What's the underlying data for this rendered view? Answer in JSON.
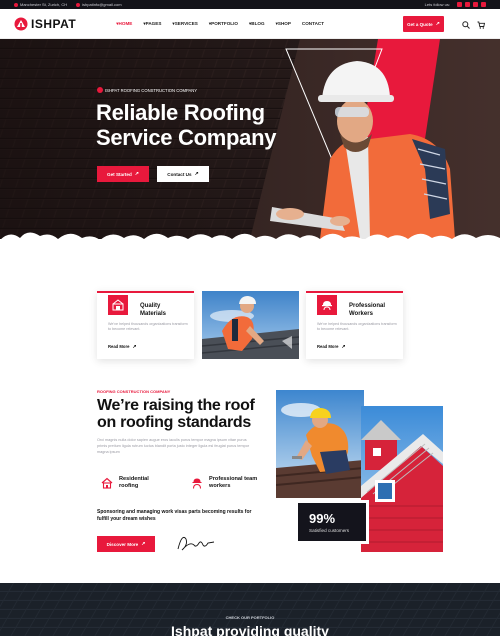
{
  "topbar": {
    "address": "Manchester St, Zurich, CH",
    "email": "ishpatinfo@gmail.com",
    "follow_label": "Lets follow us:",
    "social_icons": [
      "facebook-icon",
      "instagram-icon",
      "twitter-icon",
      "youtube-icon"
    ]
  },
  "nav": {
    "logo": "ISHPAT",
    "menu": [
      {
        "label": "HOME",
        "active": true
      },
      {
        "label": "PAGES",
        "active": false
      },
      {
        "label": "SERVICES",
        "active": false
      },
      {
        "label": "PORTFOLIO",
        "active": false
      },
      {
        "label": "BLOG",
        "active": false
      },
      {
        "label": "SHOP",
        "active": false
      },
      {
        "label": "CONTACT",
        "active": false
      }
    ],
    "quote_button": "Get a Quote",
    "search_icon": "search-icon",
    "cart_icon": "cart-icon"
  },
  "hero": {
    "tag": "ISHPAT ROOFING CONSTRUCTION COMPANY",
    "title": "Reliable Roofing Service Company",
    "primary_button": "Get Started",
    "secondary_button": "Contact Us"
  },
  "cards": [
    {
      "title": "Quality Materials",
      "text": "We've helped thousands organizations transform to become relevant.",
      "link": "Read More"
    },
    {
      "title": "Professional Workers",
      "text": "We've helped thousands organizations transform to become relevant.",
      "link": "Read More"
    }
  ],
  "about": {
    "tag": "ROOFING CONSTRUCTION COMPANY",
    "title": "We’re raising the roof on roofing standards",
    "text": "Orci magnis nulla dolor sapien augue eros iaculis purus tempor magna ipsum vitae purus primis pretium ligula rutrum luctus blandit porta justo integer ligula esl feugiat purus tempor magna ipsum",
    "features": [
      "Residential roofing",
      "Professional team workers"
    ],
    "subtitle": "Sponsoring and managing work visas parts becoming results for fulfill your dream wishes",
    "button": "Discover More",
    "stat_value": "99%",
    "stat_label": "Satisfied customers"
  },
  "portfolio": {
    "tag": "CHECK OUR PORTFOLIO",
    "title": "Ishpat providing quality"
  },
  "colors": {
    "accent": "#e8193c",
    "dark": "#131319"
  }
}
